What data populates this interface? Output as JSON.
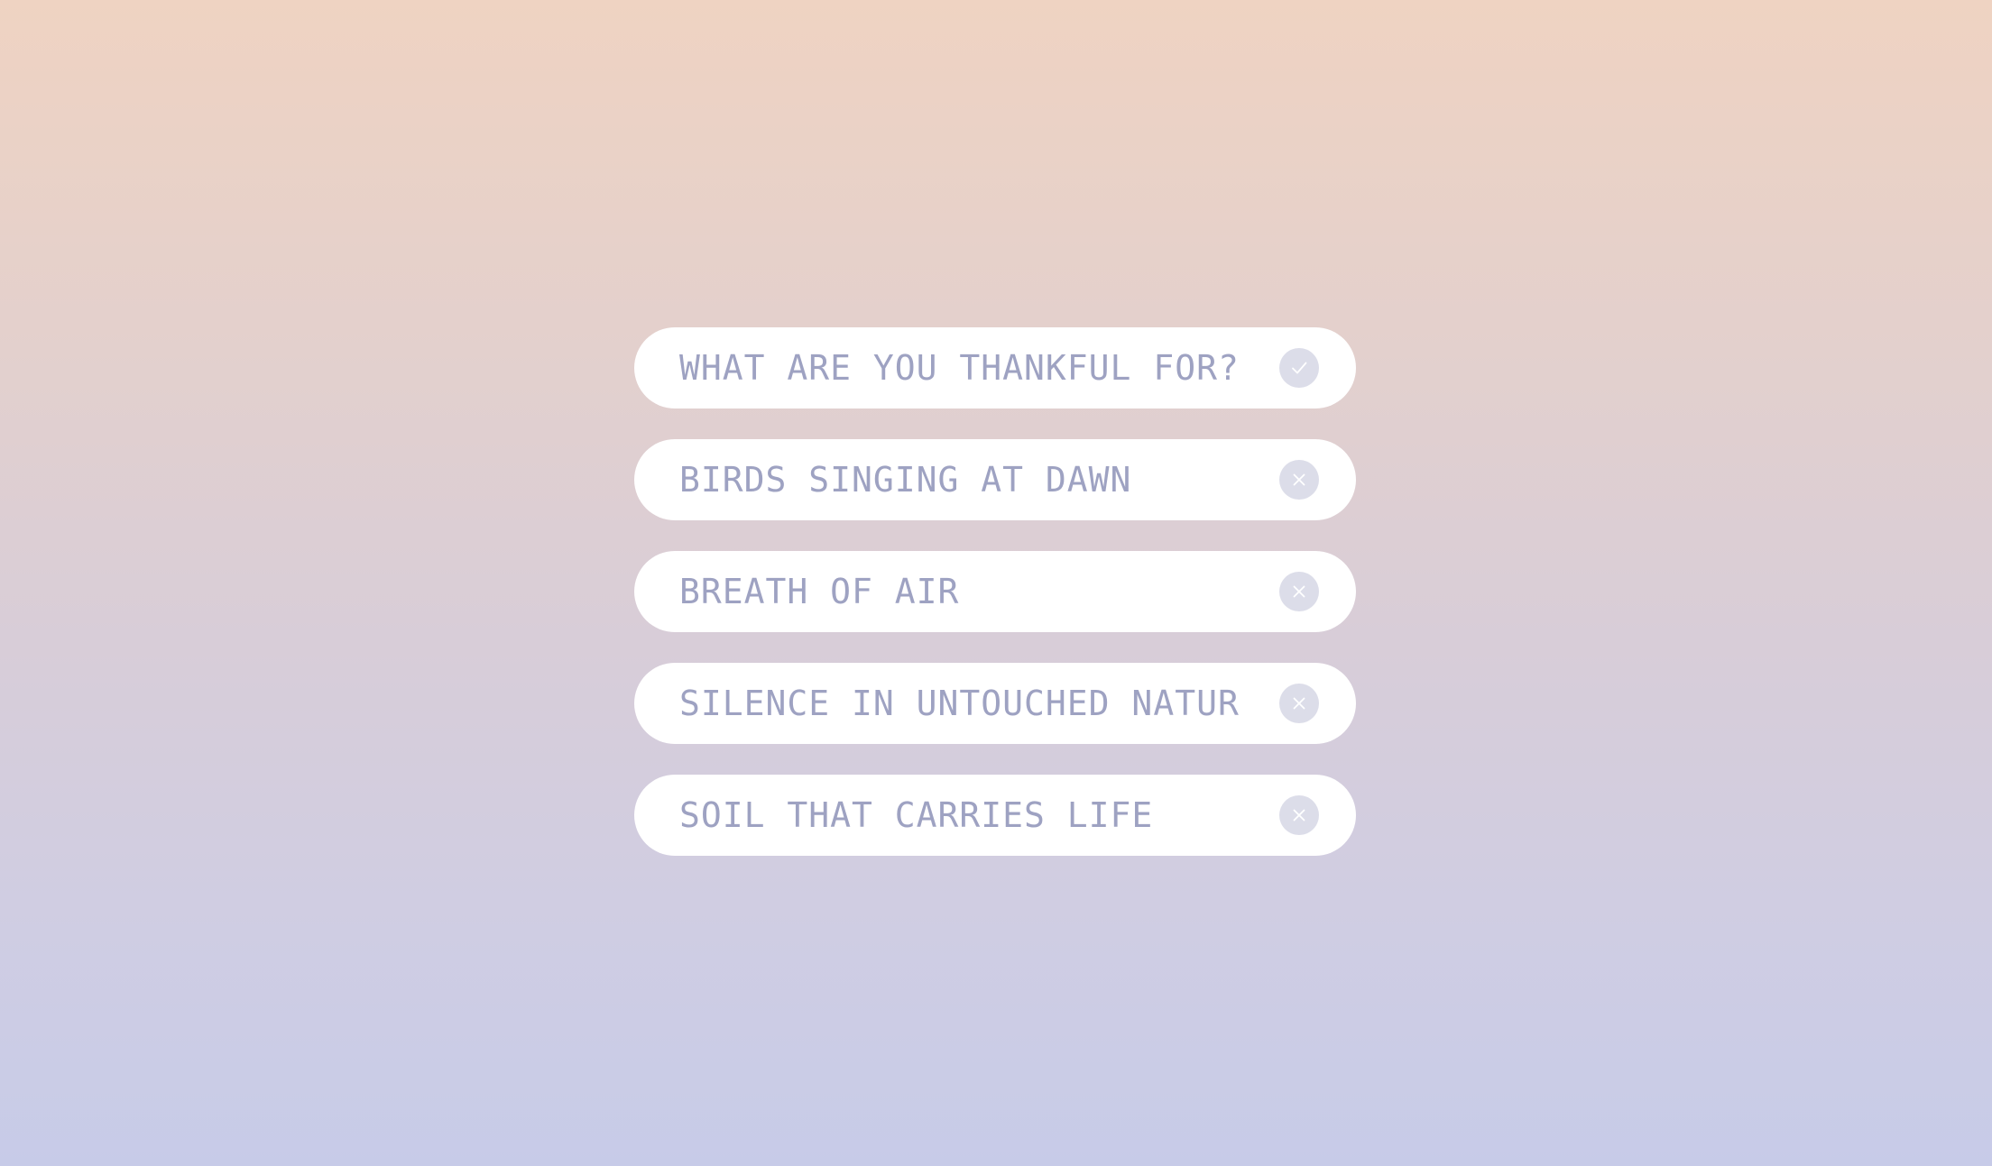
{
  "prompt": {
    "placeholder": "WHAT ARE YOU THANKFUL FOR?",
    "action_icon": "check-icon"
  },
  "entries": [
    {
      "text": "BIRDS SINGING AT DAWN",
      "action_icon": "close-icon"
    },
    {
      "text": "BREATH OF AIR",
      "action_icon": "close-icon"
    },
    {
      "text": "SILENCE IN UNTOUCHED NATUR",
      "action_icon": "close-icon"
    },
    {
      "text": "SOIL THAT CARRIES LIFE",
      "action_icon": "close-icon"
    }
  ],
  "colors": {
    "background_top": "#efd3c2",
    "background_bottom": "#c7cbe8",
    "pill": "#ffffff",
    "text": "#9ea2c2",
    "icon_circle": "#dcdde9",
    "icon_glyph": "#ffffff"
  }
}
